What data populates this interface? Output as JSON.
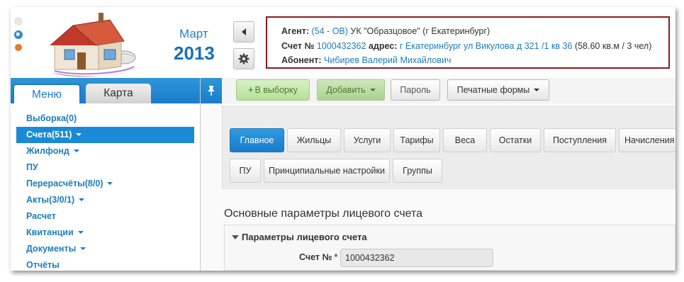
{
  "header": {
    "month": "Март",
    "year": "2013",
    "colors": {
      "accent": "#1b7ccb",
      "info_border": "#8b1a1f",
      "dot_blue": "#2b8ad8",
      "dot_orange": "#e8782c"
    }
  },
  "info": {
    "agent_label": "Агент:",
    "agent_code": "(54 - ОВ)",
    "agent_name": "УК \"Образцовое\" (г Екатеринбург)",
    "account_label": "Счет №",
    "account_number": "1000432362",
    "address_label": "адрес:",
    "address_value": "г Екатеринбург ул Викулова д 321 /1 кв 36",
    "area": "(58.60 кв.м / 3 чел)",
    "subscriber_label": "Абонент:",
    "subscriber_name": "Чибирев Валерий Михайлович"
  },
  "left_tabs": {
    "menu": "Меню",
    "map": "Карта"
  },
  "menu_items": [
    {
      "label": "Выборка(0)",
      "caret": false
    },
    {
      "label": "Счета(511)",
      "caret": true
    },
    {
      "label": "Жилфонд",
      "caret": true
    },
    {
      "label": "ПУ",
      "caret": false
    },
    {
      "label": "Перерасчёты(8/0)",
      "caret": true
    },
    {
      "label": "Акты(3/0/1)",
      "caret": true
    },
    {
      "label": "Расчет",
      "caret": false
    },
    {
      "label": "Квитанции",
      "caret": true
    },
    {
      "label": "Документы",
      "caret": true
    },
    {
      "label": "Отчёты",
      "caret": false
    }
  ],
  "toolbar": {
    "to_selection": "В выборку",
    "add": "Добавить",
    "password": "Пароль",
    "print_forms": "Печатные формы"
  },
  "content_tabs_row1": [
    "Главное",
    "Жильцы",
    "Услуги",
    "Тарифы",
    "Веса",
    "Остатки",
    "Поступления",
    "Начисления"
  ],
  "content_tabs_row2": [
    "ПУ",
    "Принципиальные настройки",
    "Группы"
  ],
  "section": {
    "title": "Основные параметры лицевого счета",
    "group_title": "Параметры лицевого счета",
    "account_field_label": "Счет №",
    "account_field_value": "1000432362"
  }
}
